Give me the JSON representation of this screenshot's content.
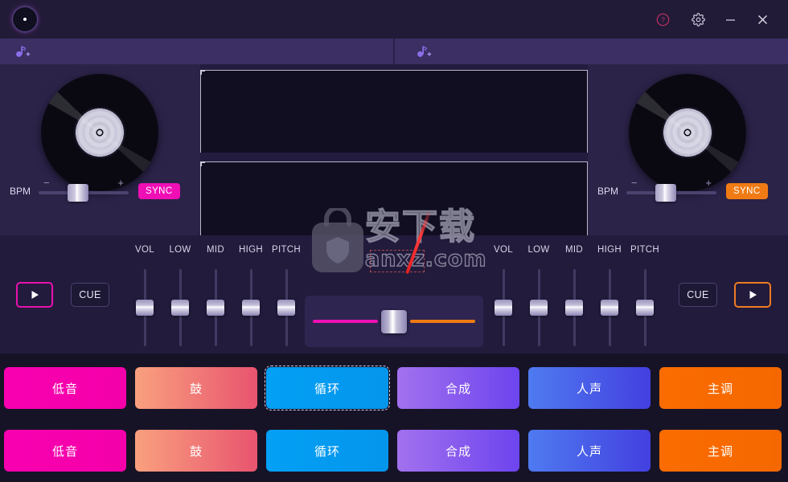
{
  "app": {
    "logo_icon": "vinyl-record-logo"
  },
  "titlebar": {
    "buttons": [
      {
        "name": "help-button",
        "icon": "question-circle-icon",
        "label": "?",
        "color": "#c0306a"
      },
      {
        "name": "settings-button",
        "icon": "gear-icon",
        "label": "",
        "color": "#c8c5d8"
      },
      {
        "name": "minimize-button",
        "icon": "minimize-icon",
        "label": "—",
        "color": "#c8c5d8"
      },
      {
        "name": "close-button",
        "icon": "close-icon",
        "label": "✕",
        "color": "#dedbe9"
      }
    ]
  },
  "loadbar": {
    "left": {
      "icon": "add-music-note-icon",
      "label": ""
    },
    "right": {
      "icon": "add-music-note-icon",
      "label": ""
    }
  },
  "decks": {
    "left": {
      "turntable_icon": "vinyl-turntable",
      "bpm_label": "BPM",
      "bpm_minus": "−",
      "bpm_plus": "+",
      "bpm_position_pct": 42,
      "sync_label": "SYNC",
      "sync_color": "#ef0fb5",
      "play_label": "▶",
      "play_color": "#e811ae",
      "cue_label": "CUE"
    },
    "right": {
      "turntable_icon": "vinyl-turntable",
      "bpm_label": "BPM",
      "bpm_minus": "−",
      "bpm_plus": "+",
      "bpm_position_pct": 42,
      "sync_label": "SYNC",
      "sync_color": "#f07b14",
      "play_label": "▶",
      "play_color": "#ef7b24",
      "cue_label": "CUE"
    }
  },
  "waveforms": {
    "top": {
      "label": "",
      "content": ""
    },
    "bottom": {
      "label": "",
      "content": ""
    }
  },
  "mixer": {
    "left_channels": [
      {
        "label": "VOL",
        "value_pct": 50
      },
      {
        "label": "LOW",
        "value_pct": 50
      },
      {
        "label": "MID",
        "value_pct": 50
      },
      {
        "label": "HIGH",
        "value_pct": 50
      },
      {
        "label": "PITCH",
        "value_pct": 50
      }
    ],
    "right_channels": [
      {
        "label": "VOL",
        "value_pct": 50
      },
      {
        "label": "LOW",
        "value_pct": 50
      },
      {
        "label": "MID",
        "value_pct": 50
      },
      {
        "label": "HIGH",
        "value_pct": 50
      },
      {
        "label": "PITCH",
        "value_pct": 50
      }
    ],
    "crossfader": {
      "position_pct": 50,
      "left_color": "#ef0fb5",
      "right_color": "#f07b14"
    }
  },
  "pads": {
    "row1": [
      {
        "label": "低音",
        "color": "#f800b0",
        "gradient": "linear-gradient(90deg,#f800b0,#f400aa)",
        "focused": false
      },
      {
        "label": "鼓",
        "color": "#f08a72",
        "gradient": "linear-gradient(90deg,#f9a07e,#e8546f)",
        "focused": false
      },
      {
        "label": "循环",
        "color": "#039ef4",
        "gradient": "linear-gradient(90deg,#03a0f5,#0495ec)",
        "focused": true
      },
      {
        "label": "合成",
        "color": "#8b5cf0",
        "gradient": "linear-gradient(90deg,#a271ee,#6d44ee)",
        "focused": false
      },
      {
        "label": "人声",
        "color": "#4a6ae8",
        "gradient": "linear-gradient(90deg,#4f7af0,#4340e0)",
        "focused": false
      },
      {
        "label": "主调",
        "color": "#f86a00",
        "gradient": "linear-gradient(90deg,#fa6c00,#f56800)",
        "focused": false
      }
    ],
    "row2": [
      {
        "label": "低音",
        "color": "#f800b0",
        "gradient": "linear-gradient(90deg,#f800b0,#f400aa)",
        "focused": false
      },
      {
        "label": "鼓",
        "color": "#f08a72",
        "gradient": "linear-gradient(90deg,#f9a07e,#e8546f)",
        "focused": false
      },
      {
        "label": "循环",
        "color": "#039ef4",
        "gradient": "linear-gradient(90deg,#03a0f5,#0495ec)",
        "focused": false
      },
      {
        "label": "合成",
        "color": "#8b5cf0",
        "gradient": "linear-gradient(90deg,#a271ee,#6d44ee)",
        "focused": false
      },
      {
        "label": "人声",
        "color": "#4a6ae8",
        "gradient": "linear-gradient(90deg,#4f7af0,#4340e0)",
        "focused": false
      },
      {
        "label": "主调",
        "color": "#f86a00",
        "gradient": "linear-gradient(90deg,#fa6c00,#f56800)",
        "focused": false
      }
    ]
  },
  "watermark": {
    "text": "安下载",
    "subtext": "anxz.com",
    "icon": "app-store-bag-icon"
  }
}
